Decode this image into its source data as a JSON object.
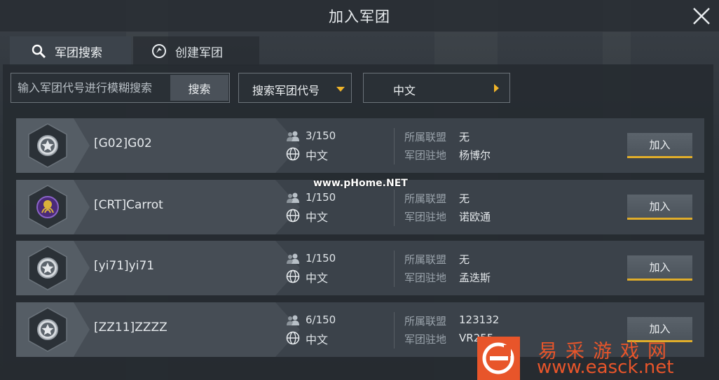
{
  "header": {
    "title": "加入军团"
  },
  "tabs": [
    {
      "label": "军团搜索",
      "icon": "search-icon",
      "active": true
    },
    {
      "label": "创建军团",
      "icon": "create-legion-icon",
      "active": false
    }
  ],
  "search": {
    "placeholder": "输入军团代号进行模糊搜索",
    "button_label": "搜索"
  },
  "filters": {
    "search_type": "搜索军团代号",
    "language": "中文"
  },
  "labels": {
    "alliance": "所属联盟",
    "station": "军团驻地",
    "join": "加入"
  },
  "legions": [
    {
      "name": "[G02]G02",
      "members": "3/150",
      "language": "中文",
      "alliance": "无",
      "station": "杨博尔",
      "emblem": "star-emblem"
    },
    {
      "name": "[CRT]Carrot",
      "members": "1/150",
      "language": "中文",
      "alliance": "无",
      "station": "诺欧通",
      "emblem": "octopus-emblem"
    },
    {
      "name": "[yi71]yi71",
      "members": "1/150",
      "language": "中文",
      "alliance": "无",
      "station": "孟迭斯",
      "emblem": "star-emblem"
    },
    {
      "name": "[ZZ11]ZZZZ",
      "members": "6/150",
      "language": "中文",
      "alliance": "123132",
      "station": "VR255",
      "emblem": "star-emblem"
    }
  ],
  "watermarks": {
    "overlay": "www.pHome.NET",
    "brand": "易采游戏网",
    "url": "www.easck.net"
  },
  "colors": {
    "accent": "#f0b429",
    "brand": "#e8552a",
    "row_bg": "#3b424a"
  }
}
